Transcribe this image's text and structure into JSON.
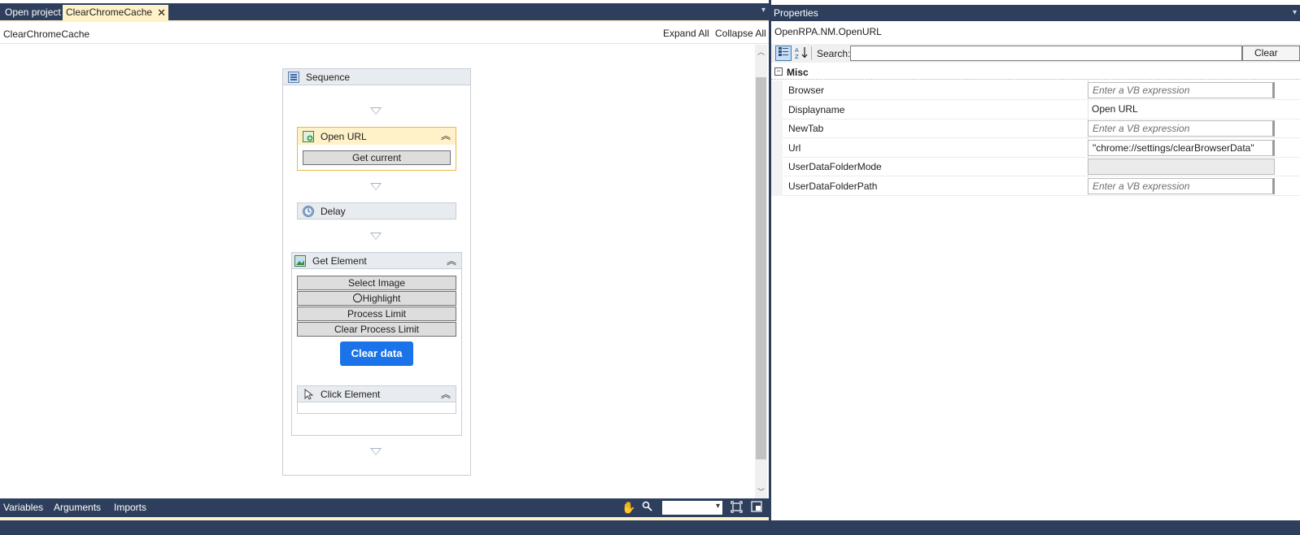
{
  "tabs": {
    "open_project": "Open project",
    "active": "ClearChromeCache",
    "close_glyph": "✕"
  },
  "designer": {
    "breadcrumb": "ClearChromeCache",
    "expand_all": "Expand All",
    "collapse_all": "Collapse All"
  },
  "workflow": {
    "sequence": "Sequence",
    "open_url": {
      "title": "Open URL",
      "button": "Get current"
    },
    "delay": "Delay",
    "get_element": {
      "title": "Get Element",
      "buttons": [
        "Select Image",
        "Highlight",
        "Process Limit",
        "Clear Process Limit"
      ],
      "image_button": "Clear data"
    },
    "click_element": "Click Element"
  },
  "bottom": {
    "variables": "Variables",
    "arguments": "Arguments",
    "imports": "Imports",
    "zoom_value": ""
  },
  "properties": {
    "title": "Properties",
    "type_name": "OpenRPA.NM.OpenURL",
    "search_label": "Search:",
    "search_value": "",
    "clear_button": "Clear",
    "category": "Misc",
    "rows": [
      {
        "name": "Browser",
        "value": "Enter a VB expression"
      },
      {
        "name": "Displayname",
        "value": "Open URL"
      },
      {
        "name": "NewTab",
        "value": "Enter a VB expression"
      },
      {
        "name": "Url",
        "value": "\"chrome://settings/clearBrowserData\""
      },
      {
        "name": "UserDataFolderMode",
        "value": ""
      },
      {
        "name": "UserDataFolderPath",
        "value": "Enter a VB expression"
      }
    ]
  },
  "colors": {
    "chrome_dark": "#2e3f5d",
    "active_tab": "#fff1c8",
    "selected_border": "#e8b84a",
    "clear_data_blue": "#1a73e8"
  },
  "icons": [
    "close-icon",
    "menu-arrow-icon",
    "sequence-icon",
    "open-url-icon",
    "delay-icon",
    "get-element-icon",
    "click-element-icon",
    "collapse-chevron-icon",
    "magnifier-icon",
    "hand-pan-icon",
    "zoom-icon",
    "fit-to-screen-icon",
    "overview-icon",
    "categorized-icon",
    "sort-az-icon"
  ]
}
